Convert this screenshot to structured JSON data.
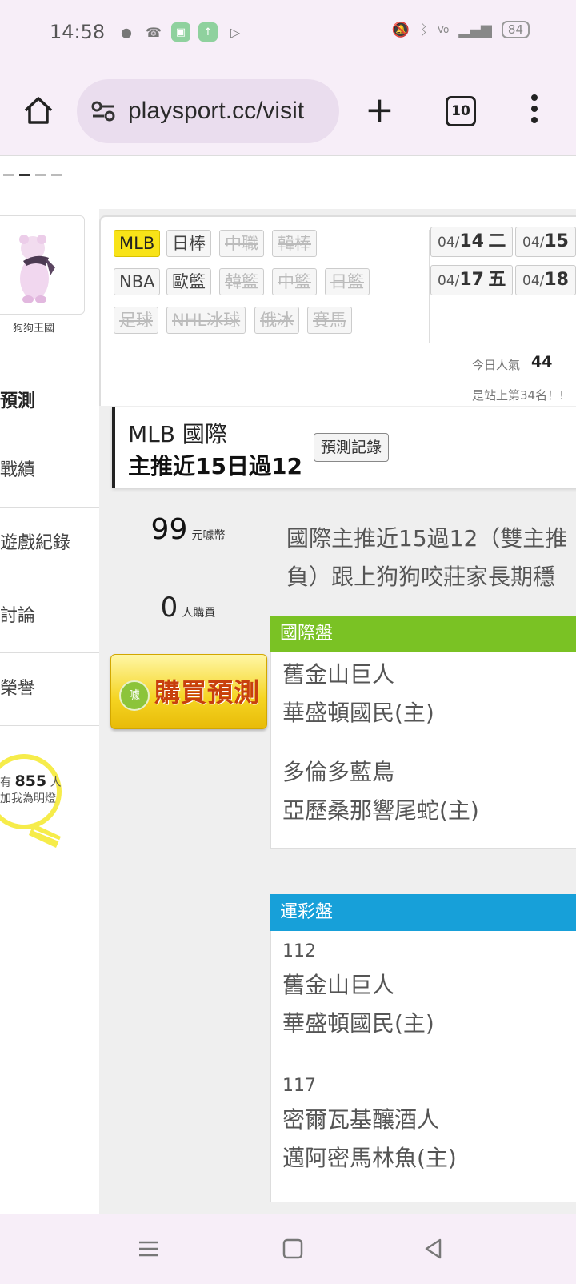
{
  "status_bar": {
    "time": "14:58",
    "battery": "84",
    "left_icons": [
      "chat-bubble-icon",
      "missed-call-icon",
      "android-icon",
      "upload-icon",
      "play-icon"
    ],
    "right_icons": [
      "mute-icon",
      "bluetooth-icon",
      "volte-icon",
      "signal-icon"
    ]
  },
  "browser": {
    "url": "playsport.cc/visit",
    "tab_count": "10"
  },
  "sidebar": {
    "avatar_name": "狗狗王國",
    "predict_heading": "預測",
    "items": [
      {
        "label": "戰績"
      },
      {
        "label": "遊戲紀錄"
      },
      {
        "label": "討論"
      },
      {
        "label": "榮譽"
      }
    ],
    "bulb": {
      "prefix": "有",
      "count": "855",
      "suffix": "人",
      "note": "加我為明燈"
    }
  },
  "sport_tags": [
    {
      "label": "MLB",
      "state": "active"
    },
    {
      "label": "日棒",
      "state": "normal"
    },
    {
      "label": "中職",
      "state": "disabled"
    },
    {
      "label": "韓棒",
      "state": "disabled"
    },
    {
      "label": "NBA",
      "state": "normal"
    },
    {
      "label": "歐籃",
      "state": "normal"
    },
    {
      "label": "韓籃",
      "state": "disabled"
    },
    {
      "label": "中籃",
      "state": "disabled"
    },
    {
      "label": "日籃",
      "state": "disabled"
    },
    {
      "label": "足球",
      "state": "disabled"
    },
    {
      "label": "NHL冰球",
      "state": "disabled"
    },
    {
      "label": "俄冰",
      "state": "disabled"
    },
    {
      "label": "賽馬",
      "state": "disabled"
    }
  ],
  "dates": [
    {
      "month": "04/",
      "day": "14",
      "weekday": "二"
    },
    {
      "month": "04/",
      "day": "15",
      "weekday": ""
    },
    {
      "month": "04/",
      "day": "17",
      "weekday": "五"
    },
    {
      "month": "04/",
      "day": "18",
      "weekday": ""
    }
  ],
  "popularity": {
    "label": "今日人氣",
    "value": "44",
    "rank_text": "是站上第34名！!"
  },
  "prediction": {
    "title_line1": "MLB 國際",
    "title_line2": "主推近15日過12",
    "record_button": "預測記錄",
    "price": "99",
    "price_unit": "元噱幣",
    "buyers": "0",
    "buyers_unit": "人購買",
    "buy_button": "購買預測",
    "buy_coin": "噱",
    "description_line1": "國際主推近15過12（雙主推",
    "description_line2": "負）跟上狗狗咬莊家長期穩"
  },
  "sections": [
    {
      "title": "國際盤",
      "color": "#7ac224",
      "matches": [
        {
          "code": "",
          "away": "舊金山巨人",
          "home": "華盛頓國民(主)"
        },
        {
          "code": "",
          "away": "多倫多藍鳥",
          "home": "亞歷桑那響尾蛇(主)"
        }
      ]
    },
    {
      "title": "運彩盤",
      "color": "#17a0d9",
      "matches": [
        {
          "code": "112",
          "away": "舊金山巨人",
          "home": "華盛頓國民(主)"
        },
        {
          "code": "117",
          "away": "密爾瓦基釀酒人",
          "home": "邁阿密馬林魚(主)"
        }
      ]
    }
  ]
}
